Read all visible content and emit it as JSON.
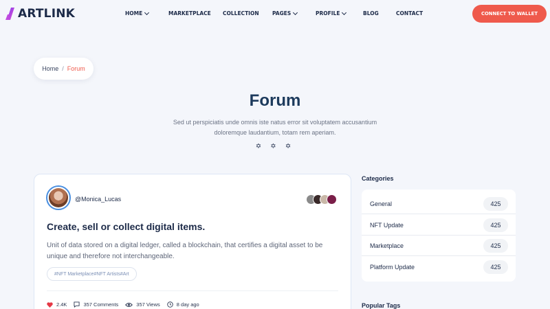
{
  "header": {
    "brand": "ARTLINK",
    "nav": [
      {
        "label": "HOME",
        "dropdown": true
      },
      {
        "label": "MARKETPLACE",
        "dropdown": false
      },
      {
        "label": "COLLECTION",
        "dropdown": false
      },
      {
        "label": "PAGES",
        "dropdown": true
      },
      {
        "label": "PROFILE",
        "dropdown": true
      },
      {
        "label": "BLOG",
        "dropdown": false
      },
      {
        "label": "CONTACT",
        "dropdown": false
      }
    ],
    "cta_label": "CONNECT TO WALLET"
  },
  "breadcrumb": {
    "home": "Home",
    "separator": "/",
    "current": "Forum"
  },
  "hero": {
    "title": "Forum",
    "subtitle": "Sed ut perspiciatis unde omnis iste natus error sit voluptatem accusantium doloremque laudantium, totam rem aperiam.",
    "stars": "✡ ✡ ✡"
  },
  "post": {
    "username": "@Monica_Lucas",
    "title": "Create, sell or collect digital items.",
    "body": "Unit of data stored on a digital ledger, called a blockchain, that certifies a digital asset to be unique and therefore not interchangeable.",
    "tags": "#NFT Marketplace#NFT Artists#Art",
    "likes": "2.4K",
    "comments": "357 Comments",
    "views": "357 Views",
    "time": "8 day ago"
  },
  "sidebar": {
    "categories_heading": "Categories",
    "categories": [
      {
        "name": "General",
        "count": "425"
      },
      {
        "name": "NFT Update",
        "count": "425"
      },
      {
        "name": "Marketplace",
        "count": "425"
      },
      {
        "name": "Platform Update",
        "count": "425"
      }
    ],
    "tags_heading": "Popular Tags"
  },
  "colors": {
    "accent": "#ef5a4c",
    "navy": "#1c2a48",
    "background": "#f4f6fb",
    "logo_gradient": [
      "#7a3cf0",
      "#e94fd1"
    ]
  },
  "icons": [
    "logo-icon",
    "chevron-down-icon",
    "heart-icon",
    "comment-icon",
    "eye-icon",
    "clock-icon",
    "star-icon"
  ]
}
